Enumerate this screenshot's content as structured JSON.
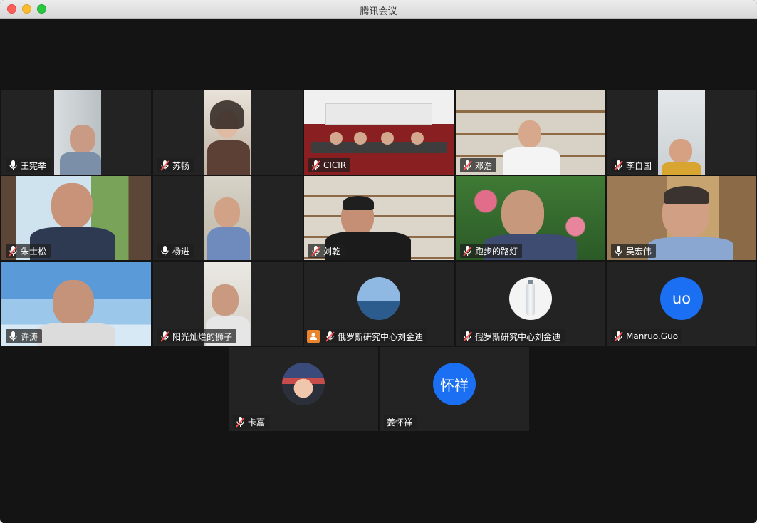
{
  "window": {
    "title": "腾讯会议"
  },
  "colors": {
    "active_border": "#3fbf4f",
    "avatar_blue": "#1a6ff2",
    "tile_bg": "#232323",
    "stage_bg": "#141414"
  },
  "participants": [
    {
      "name": "王宪举",
      "mic": "on"
    },
    {
      "name": "苏畅",
      "mic": "muted"
    },
    {
      "name": "CICIR",
      "mic": "muted"
    },
    {
      "name": "邓浩",
      "mic": "muted"
    },
    {
      "name": "李自国",
      "mic": "muted"
    },
    {
      "name": "朱士松",
      "mic": "muted"
    },
    {
      "name": "杨进",
      "mic": "on"
    },
    {
      "name": "刘乾",
      "mic": "muted"
    },
    {
      "name": "跑步的路灯",
      "mic": "muted"
    },
    {
      "name": "吴宏伟",
      "mic": "on"
    },
    {
      "name": "许涛",
      "mic": "on",
      "speaking": true
    },
    {
      "name": "阳光灿烂的狮子",
      "mic": "muted"
    },
    {
      "name": "俄罗斯研究中心刘金迪",
      "mic": "muted",
      "avatar": "sea-photo"
    },
    {
      "name": "俄罗斯研究中心刘金迪",
      "mic": "muted",
      "avatar": "bottle-photo"
    },
    {
      "name": "Manruo.Guo",
      "mic": "muted",
      "avatar_text": "uo"
    },
    {
      "name": "卡嘉",
      "mic": "muted",
      "avatar": "cartoon-photo"
    },
    {
      "name": "姜怀祥",
      "mic": "none",
      "avatar_text": "怀祥"
    }
  ]
}
